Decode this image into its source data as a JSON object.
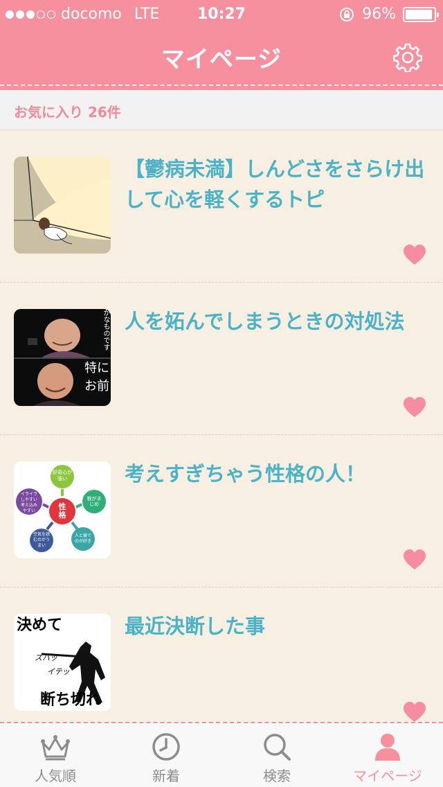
{
  "status_bar": {
    "carrier": "docomo",
    "network": "LTE",
    "time": "10:27",
    "battery": "96%",
    "battery_level": 0.96,
    "signal_bars_filled": 3,
    "signal_bars_total": 5
  },
  "nav": {
    "title": "マイページ",
    "settings_icon": "gear-icon"
  },
  "favorites": {
    "label": "お気に入り 26件"
  },
  "items": [
    {
      "title": "【鬱病未満】しんどさをさらけ出して心を軽くするトピ",
      "thumbnail": "illustration-woman-in-corner",
      "favorited": true
    },
    {
      "title": "人を妬んでしまうときの対処法",
      "thumbnail": "photo-nun-portraits",
      "thumb_text": {
        "top": "かなものです",
        "bottom_1": "特に",
        "bottom_2": "お前"
      },
      "favorited": true
    },
    {
      "title": "考えすぎちゃう性格の人！",
      "thumbnail": "personality-diagram",
      "thumb_text": {
        "center": "性格",
        "top": "好奇心が強い",
        "right": "根がまじめ",
        "bottom_right": "人と競で のが好き",
        "bottom_left": "空気を読むのがうまい",
        "left": "イライラしやすい考え込みやすい"
      },
      "favorited": true
    },
    {
      "title": "最近決断した事",
      "thumbnail": "calligraphy-samurai",
      "thumb_text": {
        "line_1": "決めて",
        "line_2": "ズバッ",
        "line_3": "イテッ",
        "line_4": "断ち切れ"
      },
      "favorited": true
    }
  ],
  "tabs": [
    {
      "label": "人気順",
      "icon": "crown-icon",
      "active": false
    },
    {
      "label": "新着",
      "icon": "clock-icon",
      "active": false
    },
    {
      "label": "検索",
      "icon": "search-icon",
      "active": false
    },
    {
      "label": "マイページ",
      "icon": "person-icon",
      "active": true
    }
  ],
  "colors": {
    "header_pink": "#f7909e",
    "title_blue": "#4bb2c8",
    "heart_pink": "#f68ca0",
    "background_cream": "#f7efe2"
  }
}
